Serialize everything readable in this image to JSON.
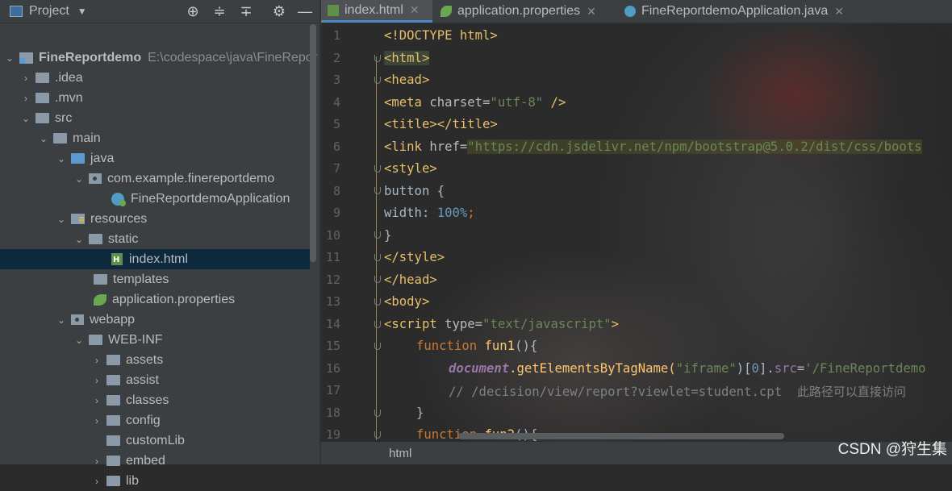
{
  "project_panel": {
    "title": "Project",
    "tree": [
      {
        "label": "FineReportdemo",
        "path": "E:\\codespace\\java\\FineRepor"
      },
      {
        "label": ".idea"
      },
      {
        "label": ".mvn"
      },
      {
        "label": "src"
      },
      {
        "label": "main"
      },
      {
        "label": "java"
      },
      {
        "label": "com.example.finereportdemo"
      },
      {
        "label": "FineReportdemoApplication"
      },
      {
        "label": "resources"
      },
      {
        "label": "static"
      },
      {
        "label": "index.html"
      },
      {
        "label": "templates"
      },
      {
        "label": "application.properties"
      },
      {
        "label": "webapp"
      },
      {
        "label": "WEB-INF"
      },
      {
        "label": "assets"
      },
      {
        "label": "assist"
      },
      {
        "label": "classes"
      },
      {
        "label": "config"
      },
      {
        "label": "customLib"
      },
      {
        "label": "embed"
      },
      {
        "label": "lib"
      }
    ]
  },
  "tabs": [
    {
      "label": "index.html"
    },
    {
      "label": "application.properties"
    },
    {
      "label": "FineReportdemoApplication.java"
    }
  ],
  "line_numbers": [
    "1",
    "2",
    "3",
    "4",
    "5",
    "6",
    "7",
    "8",
    "9",
    "10",
    "11",
    "12",
    "13",
    "14",
    "15",
    "16",
    "17",
    "18",
    "19"
  ],
  "code": {
    "l1": "<!DOCTYPE html>",
    "l2": "<html>",
    "l3": "<head>",
    "l4a": "<meta ",
    "l4b": "charset",
    "l4c": "=",
    "l4d": "\"utf-8\"",
    "l4e": " />",
    "l5": "<title></title>",
    "l6a": "<link ",
    "l6b": "href",
    "l6c": "=",
    "l6d": "\"https://cdn.jsdelivr.net/npm/bootstrap@5.0.2/dist/css/boots",
    "l7": "<style>",
    "l8": "button {",
    "l9a": "width: ",
    "l9b": "100%",
    "l9c": ";",
    "l10": "}",
    "l11": "</style>",
    "l12": "</head>",
    "l13": "<body>",
    "l14a": "<script ",
    "l14b": "type",
    "l14c": "=",
    "l14d": "\"text/javascript\"",
    "l14e": ">",
    "l15a": "function ",
    "l15b": "fun1",
    "l15c": "(){",
    "l16a": "document",
    "l16b": ".getElementsByTagName(",
    "l16c": "\"iframe\"",
    "l16d": ")[",
    "l16e": "0",
    "l16f": "].",
    "l16g": "src",
    "l16h": "=",
    "l16i": "'/FineReportdemo",
    "l17a": "// /decision/view/report?viewlet=student.cpt  ",
    "l17b": "此路径可以直接访问",
    "l18": "}",
    "l19a": "function ",
    "l19b": "fun2",
    "l19c": "(){"
  },
  "breadcrumb": "html",
  "watermark": "CSDN @狩生集"
}
